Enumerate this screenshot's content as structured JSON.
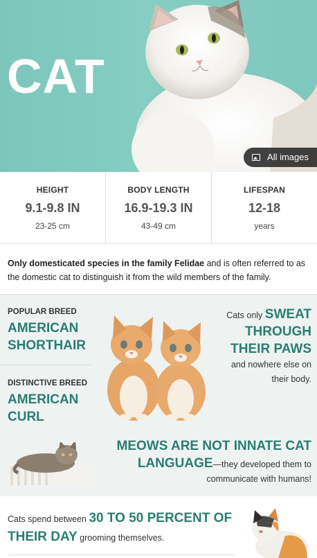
{
  "hero": {
    "title": "CAT",
    "all_images_label": "All images"
  },
  "stats": [
    {
      "label": "HEIGHT",
      "value": "9.1-9.8 IN",
      "sub": "23-25 cm"
    },
    {
      "label": "BODY LENGTH",
      "value": "16.9-19.3 IN",
      "sub": "43-49 cm"
    },
    {
      "label": "LIFESPAN",
      "value": "12-18",
      "sub": "years"
    }
  ],
  "description": {
    "bold": "Only domesticated species in the family Felidae",
    "rest": " and is often referred to as the domestic cat to distinguish it from the wild members of the family."
  },
  "facts": {
    "popular_breed": {
      "label": "POPULAR BREED",
      "name_line1": "AMERICAN",
      "name_line2": "SHORTHAIR"
    },
    "distinctive_breed": {
      "label": "DISTINCTIVE BREED",
      "name_line1": "AMERICAN",
      "name_line2": "CURL"
    },
    "sweat": {
      "prefix": "Cats only ",
      "highlight_line1": "SWEAT",
      "highlight_line2": "THROUGH",
      "highlight_line3": "THEIR PAWS",
      "suffix": "and nowhere else on their body."
    },
    "meows": {
      "highlight_line1": "MEOWS ARE NOT INNATE CAT",
      "highlight_line2": "LANGUAGE",
      "suffix": "—they developed them to communicate with humans!"
    }
  },
  "grooming": {
    "prefix": "Cats spend between ",
    "highlight": "30 TO 50 PERCENT OF THEIR DAY",
    "suffix": " grooming themselves."
  },
  "colors": {
    "accent": "#2a7d72",
    "hero_bg": "#86cdc2",
    "facts_bg": "#eef3f2"
  },
  "icons": {
    "all_images": "image-icon"
  }
}
